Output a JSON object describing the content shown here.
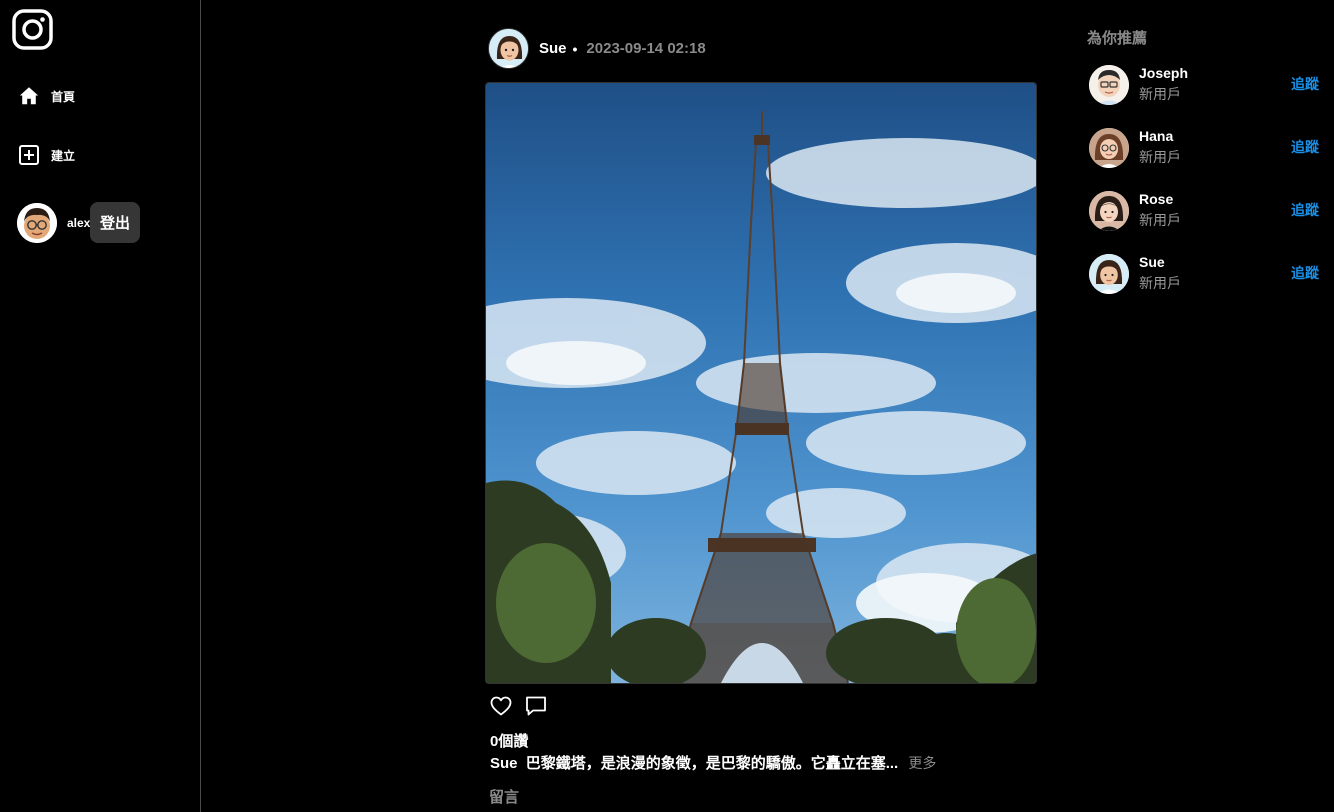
{
  "sidebar": {
    "logo_icon": "instagram-icon",
    "items": [
      {
        "label": "首頁",
        "icon": "home-icon"
      },
      {
        "label": "建立",
        "icon": "plus-square-icon"
      }
    ],
    "profile": {
      "username": "alex"
    },
    "logout_label": "登出"
  },
  "post": {
    "username": "Sue",
    "separator": "•",
    "timestamp": "2023-09-14 02:18",
    "likes_text": "0個讚",
    "caption_user": "Sue",
    "caption_text": "巴黎鐵塔，是浪漫的象徵，是巴黎的驕傲。它矗立在塞...",
    "more_label": "更多",
    "comment_label": "留言"
  },
  "suggestions": {
    "title": "為你推薦",
    "follow_label": "追蹤",
    "users": [
      {
        "name": "Joseph",
        "subtitle": "新用戶"
      },
      {
        "name": "Hana",
        "subtitle": "新用戶"
      },
      {
        "name": "Rose",
        "subtitle": "新用戶"
      },
      {
        "name": "Sue",
        "subtitle": "新用戶"
      }
    ]
  },
  "colors": {
    "background": "#000000",
    "link_blue": "#1a8fe6",
    "muted_gray": "#8a8a8a",
    "logout_bg": "#363636"
  }
}
